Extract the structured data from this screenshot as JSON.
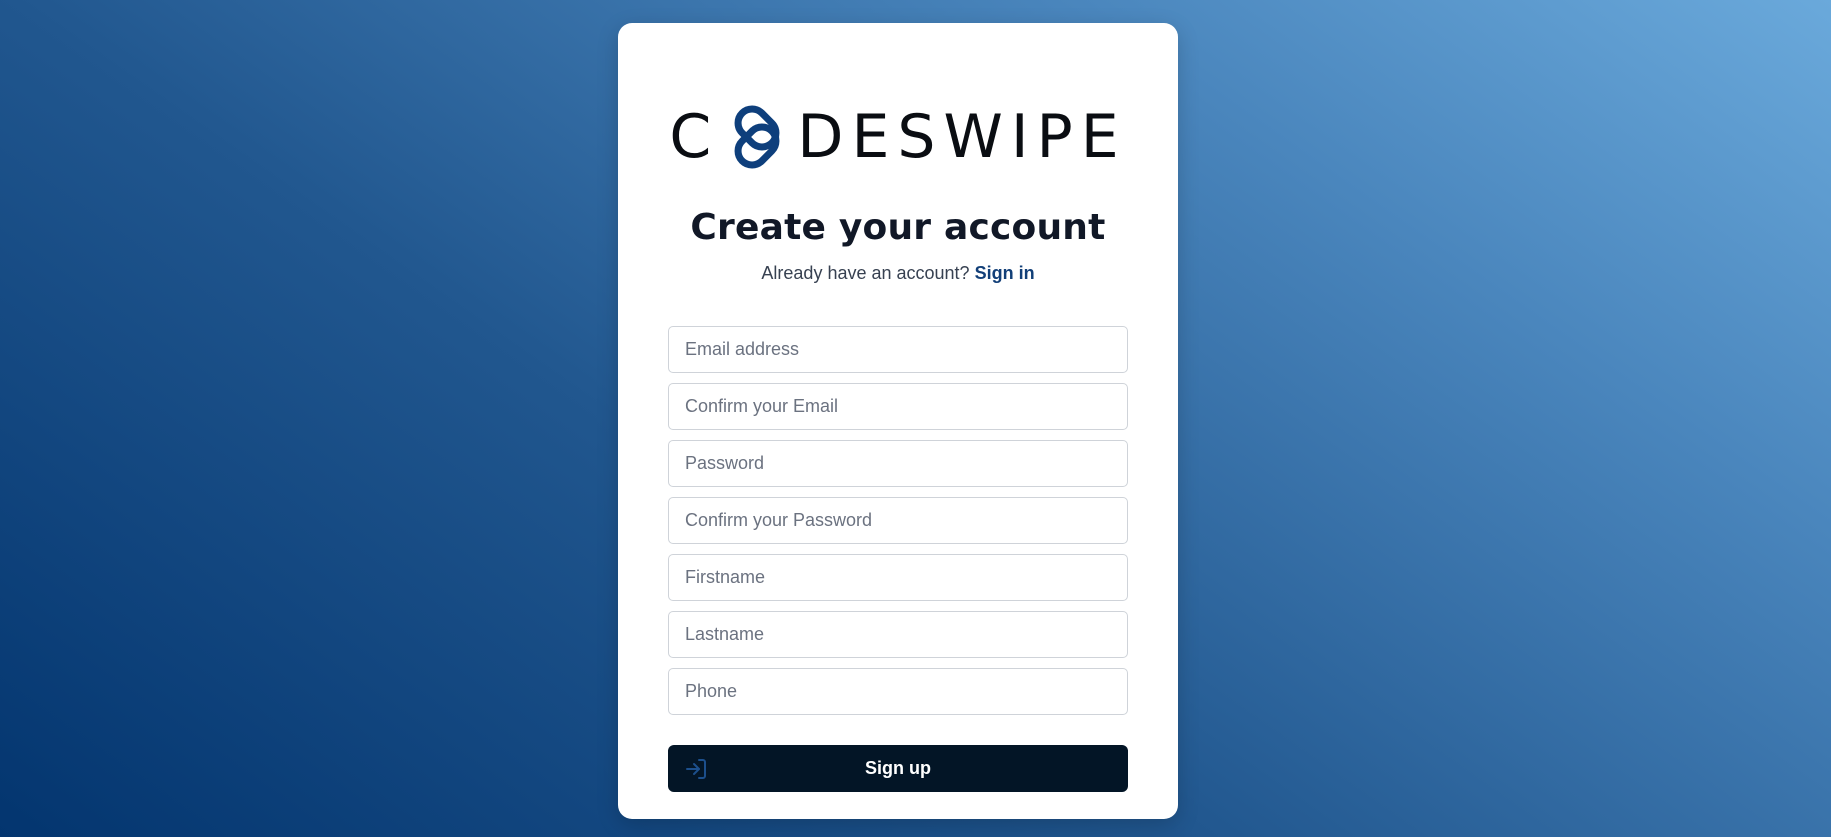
{
  "brand": {
    "logo_prefix": "C",
    "logo_suffix": "DESWIPE",
    "logo_mark_icon": "interlocking-knot-icon",
    "brand_color": "#0e3f7c"
  },
  "heading": {
    "title": "Create your account",
    "prompt": "Already have an account?",
    "signin_link": "Sign in"
  },
  "form": {
    "email_placeholder": "Email address",
    "confirm_email_placeholder": "Confirm your Email",
    "password_placeholder": "Password",
    "confirm_password_placeholder": "Confirm your Password",
    "firstname_placeholder": "Firstname",
    "lastname_placeholder": "Lastname",
    "phone_placeholder": "Phone"
  },
  "submit": {
    "label": "Sign up",
    "icon": "sign-in-arrow-icon",
    "background": "#031526"
  }
}
